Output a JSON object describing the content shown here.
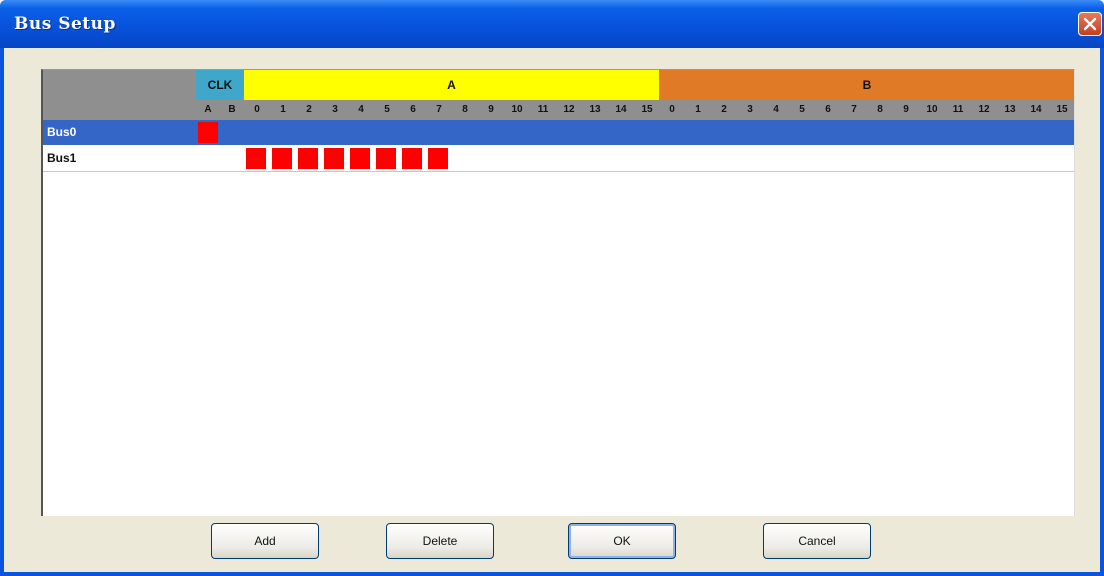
{
  "window": {
    "title": "Bus Setup",
    "close_icon": "close-icon"
  },
  "header": {
    "groups": [
      {
        "label": "CLK",
        "color": "#3fa7c9"
      },
      {
        "label": "A",
        "color": "#ffff00"
      },
      {
        "label": "B",
        "color": "#e07a26"
      }
    ],
    "clk_pins": [
      "A",
      "B"
    ],
    "a_pins": [
      "0",
      "1",
      "2",
      "3",
      "4",
      "5",
      "6",
      "7",
      "8",
      "9",
      "10",
      "11",
      "12",
      "13",
      "14",
      "15"
    ],
    "b_pins": [
      "0",
      "1",
      "2",
      "3",
      "4",
      "5",
      "6",
      "7",
      "8",
      "9",
      "10",
      "11",
      "12",
      "13",
      "14",
      "15"
    ]
  },
  "buses": [
    {
      "name": "Bus0",
      "selected": true,
      "assigned": {
        "clk": [
          "A"
        ],
        "a": [],
        "b": []
      }
    },
    {
      "name": "Bus1",
      "selected": false,
      "assigned": {
        "clk": [],
        "a": [
          "0",
          "1",
          "2",
          "3",
          "4",
          "5",
          "6",
          "7"
        ],
        "b": []
      }
    }
  ],
  "buttons": {
    "add": "Add",
    "delete": "Delete",
    "ok": "OK",
    "cancel": "Cancel"
  },
  "colors": {
    "assigned_cell": "#ff0000",
    "selected_row": "#3466c7"
  }
}
